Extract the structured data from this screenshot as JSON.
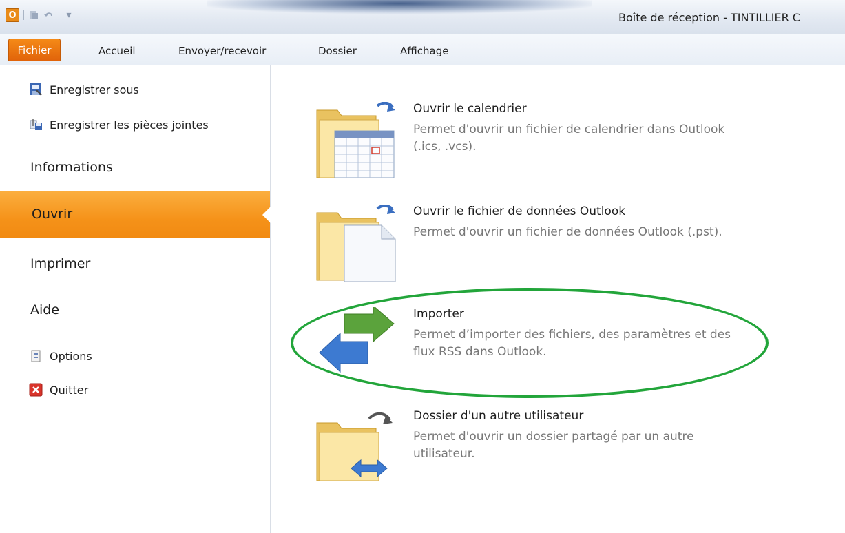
{
  "titlebar": {
    "app_icon_letter": "O",
    "window_title": "Boîte de réception - TINTILLIER C"
  },
  "ribbon": {
    "tabs": [
      {
        "label": "Fichier"
      },
      {
        "label": "Accueil"
      },
      {
        "label": "Envoyer/recevoir"
      },
      {
        "label": "Dossier"
      },
      {
        "label": "Affichage"
      }
    ]
  },
  "nav": {
    "save_as": "Enregistrer sous",
    "save_attachments": "Enregistrer les pièces jointes",
    "info": "Informations",
    "open": "Ouvrir",
    "print": "Imprimer",
    "help": "Aide",
    "options": "Options",
    "quit": "Quitter"
  },
  "content": {
    "items": [
      {
        "title": "Ouvrir le calendrier",
        "desc": "Permet d'ouvrir un fichier de calendrier dans Outlook (.ics, .vcs)."
      },
      {
        "title": "Ouvrir le fichier de données Outlook",
        "desc": "Permet d'ouvrir un fichier de données Outlook (.pst)."
      },
      {
        "title": "Importer",
        "desc": "Permet d’importer des fichiers, des paramètres et des flux RSS dans Outlook."
      },
      {
        "title": "Dossier d'un autre utilisateur",
        "desc": "Permet d'ouvrir un dossier partagé par un autre utilisateur."
      }
    ]
  },
  "colors": {
    "accent_orange": "#f59219",
    "highlight_green": "#22a53a"
  }
}
